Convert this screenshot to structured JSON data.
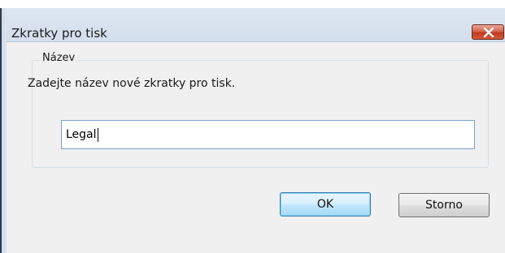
{
  "window": {
    "title": "Zkratky pro tisk",
    "close_icon": "close-icon"
  },
  "group": {
    "legend": "Název",
    "prompt": "Zadejte název nové zkratky pro tisk."
  },
  "name_input": {
    "value": "Legal"
  },
  "buttons": {
    "ok_label": "OK",
    "cancel_label": "Storno"
  },
  "colors": {
    "close_button": "#c0391f",
    "input_border": "#7da2ce",
    "ok_border": "#3c7fb1"
  }
}
